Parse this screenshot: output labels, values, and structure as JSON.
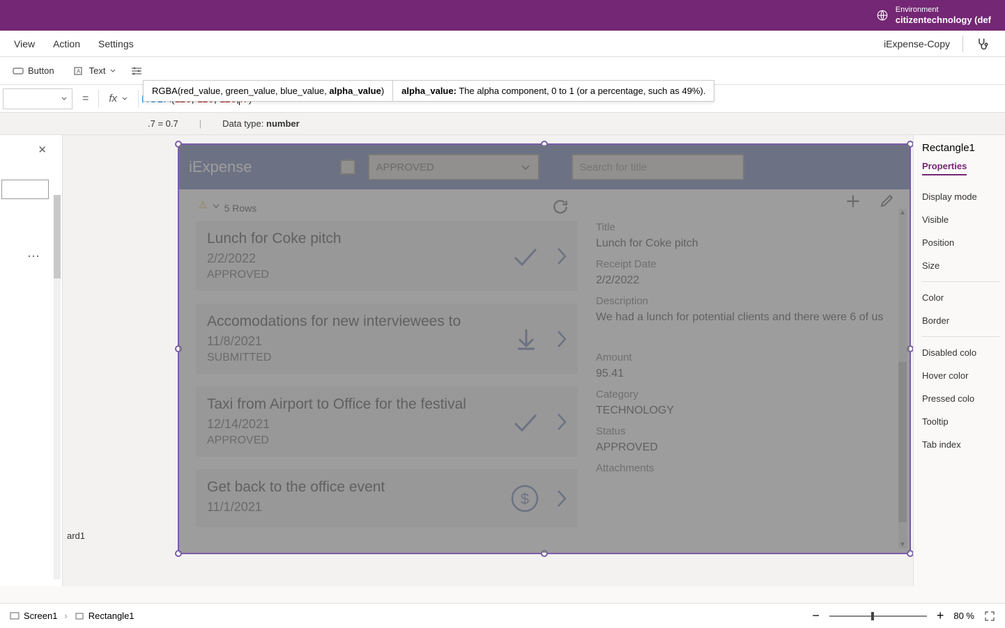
{
  "environment": {
    "label": "Environment",
    "name": "citizentechnology (def"
  },
  "menu": {
    "view": "View",
    "action": "Action",
    "settings": "Settings"
  },
  "app_name": "iExpense-Copy",
  "toolbar": {
    "button": "Button",
    "text": "Text"
  },
  "formula": {
    "signature_pre": "RGBA(red_value, green_value, blue_value, ",
    "signature_bold": "alpha_value",
    "signature_post": ")",
    "param_name": "alpha_value:",
    "param_desc": " The alpha component, 0 to 1 (or a percentage, such as 49%).",
    "fn": "RGBA",
    "arg1": "116",
    "arg2": "116",
    "arg3": "116",
    "arg4": ".7",
    "result_expr": ".7 = 0.7",
    "data_type_label": "Data type: ",
    "data_type": "number"
  },
  "app": {
    "title": "iExpense",
    "dropdown_value": "APPROVED",
    "search_placeholder": "Search for title",
    "rows_label": "5 Rows",
    "items": [
      {
        "title": "Lunch for Coke pitch",
        "date": "2/2/2022",
        "status": "APPROVED",
        "icon": "check"
      },
      {
        "title": "Accomodations for new interviewees to",
        "date": "11/8/2021",
        "status": "SUBMITTED",
        "icon": "download"
      },
      {
        "title": "Taxi from Airport to Office for the festival",
        "date": "12/14/2021",
        "status": "APPROVED",
        "icon": "check"
      },
      {
        "title": "Get back to the office event",
        "date": "11/1/2021",
        "status": "",
        "icon": "dollar"
      }
    ],
    "detail": {
      "title_label": "Title",
      "title_value": "Lunch for Coke pitch",
      "date_label": "Receipt Date",
      "date_value": "2/2/2022",
      "desc_label": "Description",
      "desc_value": "We had a lunch for potential clients and there were 6 of us",
      "amount_label": "Amount",
      "amount_value": "95.41",
      "category_label": "Category",
      "category_value": "TECHNOLOGY",
      "status_label": "Status",
      "status_value": "APPROVED",
      "attach_label": "Attachments"
    }
  },
  "props": {
    "element": "Rectangle1",
    "tab": "Properties",
    "rows": [
      "Display mode",
      "Visible",
      "Position",
      "Size",
      "Color",
      "Border",
      "Disabled colo",
      "Hover color",
      "Pressed colo",
      "Tooltip",
      "Tab index"
    ]
  },
  "tree_label": "ard1",
  "breadcrumb": {
    "screen": "Screen1",
    "element": "Rectangle1"
  },
  "zoom": "80 %"
}
